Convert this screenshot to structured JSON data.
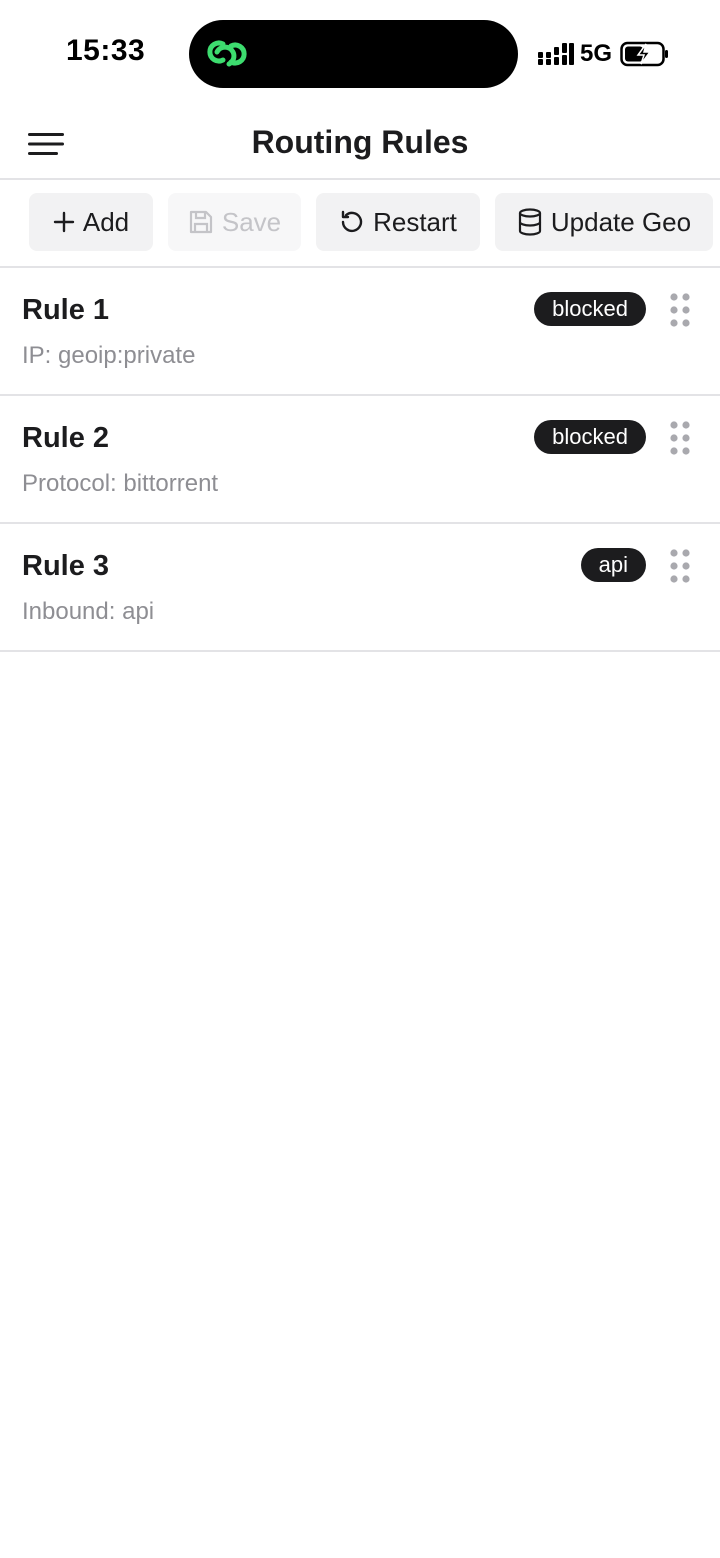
{
  "status_bar": {
    "time": "15:33",
    "network": "5G",
    "island_icon_color": "#3ddc6f"
  },
  "header": {
    "title": "Routing Rules",
    "menu_icon": "hamburger-menu-icon"
  },
  "toolbar": {
    "add_label": "Add",
    "save_label": "Save",
    "restart_label": "Restart",
    "update_geo_label": "Update Geo",
    "save_disabled": true
  },
  "rules": [
    {
      "title": "Rule 1",
      "detail": "IP: geoip:private",
      "badge": "blocked"
    },
    {
      "title": "Rule 2",
      "detail": "Protocol: bittorrent",
      "badge": "blocked"
    },
    {
      "title": "Rule 3",
      "detail": "Inbound: api",
      "badge": "api"
    }
  ],
  "colors": {
    "badge_bg": "#1c1c1e",
    "divider": "#e3e3e6",
    "button_bg": "#f2f2f3",
    "muted_text": "#8e8e93"
  }
}
